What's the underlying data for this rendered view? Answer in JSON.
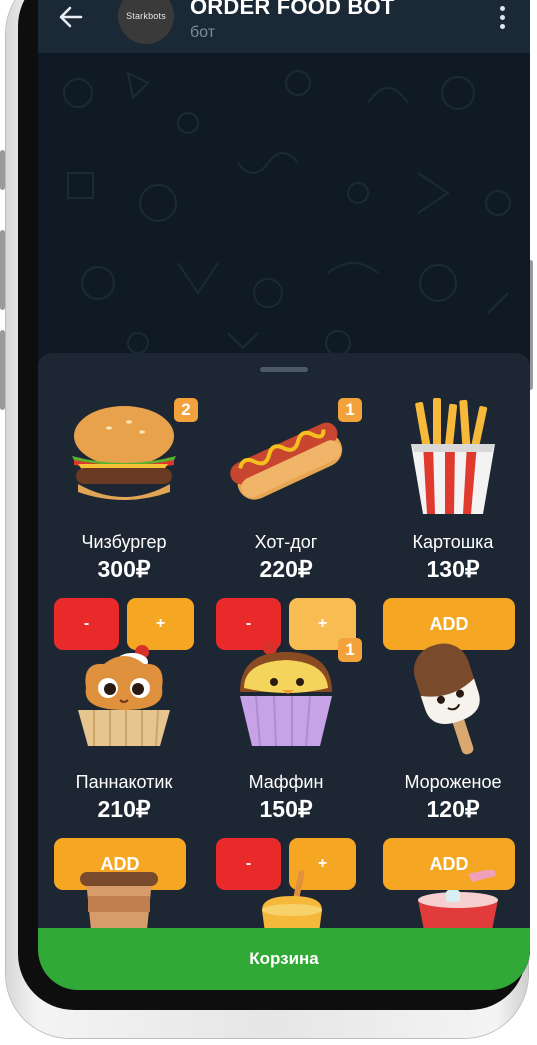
{
  "header": {
    "title": "ORDER FOOD BOT",
    "subtitle": "бот",
    "avatar_text": "Starkbots"
  },
  "menu": [
    {
      "name": "Чизбургер",
      "price": "300₽",
      "count": "2",
      "action": "stepper",
      "icon": "cheeseburger-icon"
    },
    {
      "name": "Хот-дог",
      "price": "220₽",
      "count": "1",
      "action": "stepper",
      "icon": "hotdog-icon"
    },
    {
      "name": "Картошка",
      "price": "130₽",
      "count": "",
      "action": "add",
      "icon": "fries-icon"
    },
    {
      "name": "Паннакотик",
      "price": "210₽",
      "count": "",
      "action": "add",
      "icon": "pannacotta-icon"
    },
    {
      "name": "Маффин",
      "price": "150₽",
      "count": "1",
      "action": "stepper",
      "icon": "muffin-icon"
    },
    {
      "name": "Мороженое",
      "price": "120₽",
      "count": "",
      "action": "add",
      "icon": "ice-cream-icon"
    }
  ],
  "buttons": {
    "minus": "-",
    "plus": "+",
    "add": "ADD"
  },
  "cart_label": "Корзина",
  "colors": {
    "panel": "#1d2733",
    "accent_orange": "#f5a623",
    "minus_red": "#ea2a2a",
    "cart_green": "#31a936",
    "header": "#1b2836"
  }
}
